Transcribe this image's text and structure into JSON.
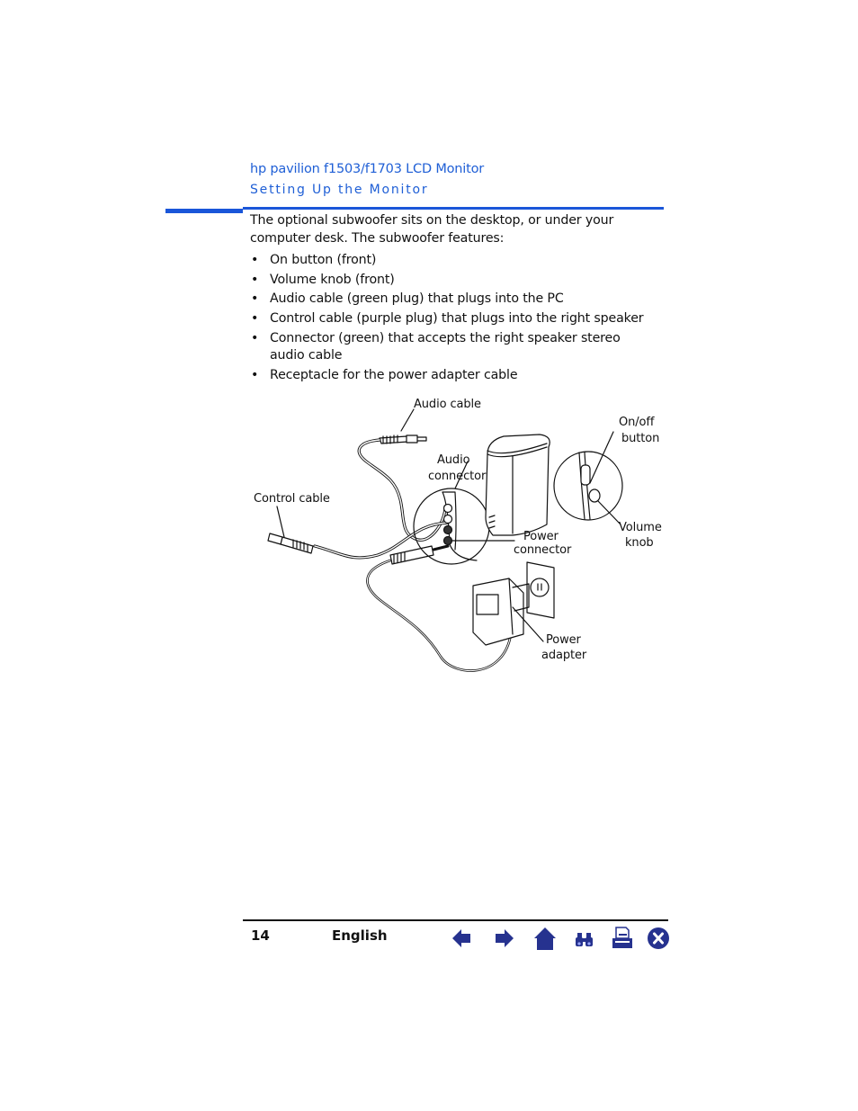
{
  "header": {
    "product": "hp pavilion f1503/f1703 LCD Monitor",
    "section": "Setting Up the Monitor",
    "accent_color": "#1a56d9"
  },
  "content": {
    "intro": "The optional subwoofer sits on the desktop, or under your computer desk. The subwoofer features:",
    "bullet_glyph": "•",
    "features": [
      "On button (front)",
      "Volume knob (front)",
      "Audio cable (green plug) that plugs into the PC",
      "Control cable (purple plug) that plugs into the right speaker",
      "Connector (green) that accepts the right speaker stereo audio cable",
      "Receptacle for the power adapter cable"
    ]
  },
  "figure": {
    "labels": {
      "audio_cable": "Audio cable",
      "audio_connector_1": "Audio",
      "audio_connector_2": "connector",
      "control_cable": "Control cable",
      "onoff_1": "On/off",
      "onoff_2": "button",
      "volume_1": "Volume",
      "volume_2": "knob",
      "power_connector_1": "Power",
      "power_connector_2": "connector",
      "power_adapter_1": "Power",
      "power_adapter_2": "adapter"
    }
  },
  "footer": {
    "page_number": "14",
    "language": "English",
    "nav_color": "#26328f",
    "nav_buttons": [
      {
        "name": "previous-page",
        "icon": "arrow-left-icon"
      },
      {
        "name": "next-page",
        "icon": "arrow-right-icon"
      },
      {
        "name": "home",
        "icon": "home-icon"
      },
      {
        "name": "search",
        "icon": "binoculars-icon"
      },
      {
        "name": "print",
        "icon": "printer-icon"
      },
      {
        "name": "close",
        "icon": "close-icon"
      }
    ]
  }
}
